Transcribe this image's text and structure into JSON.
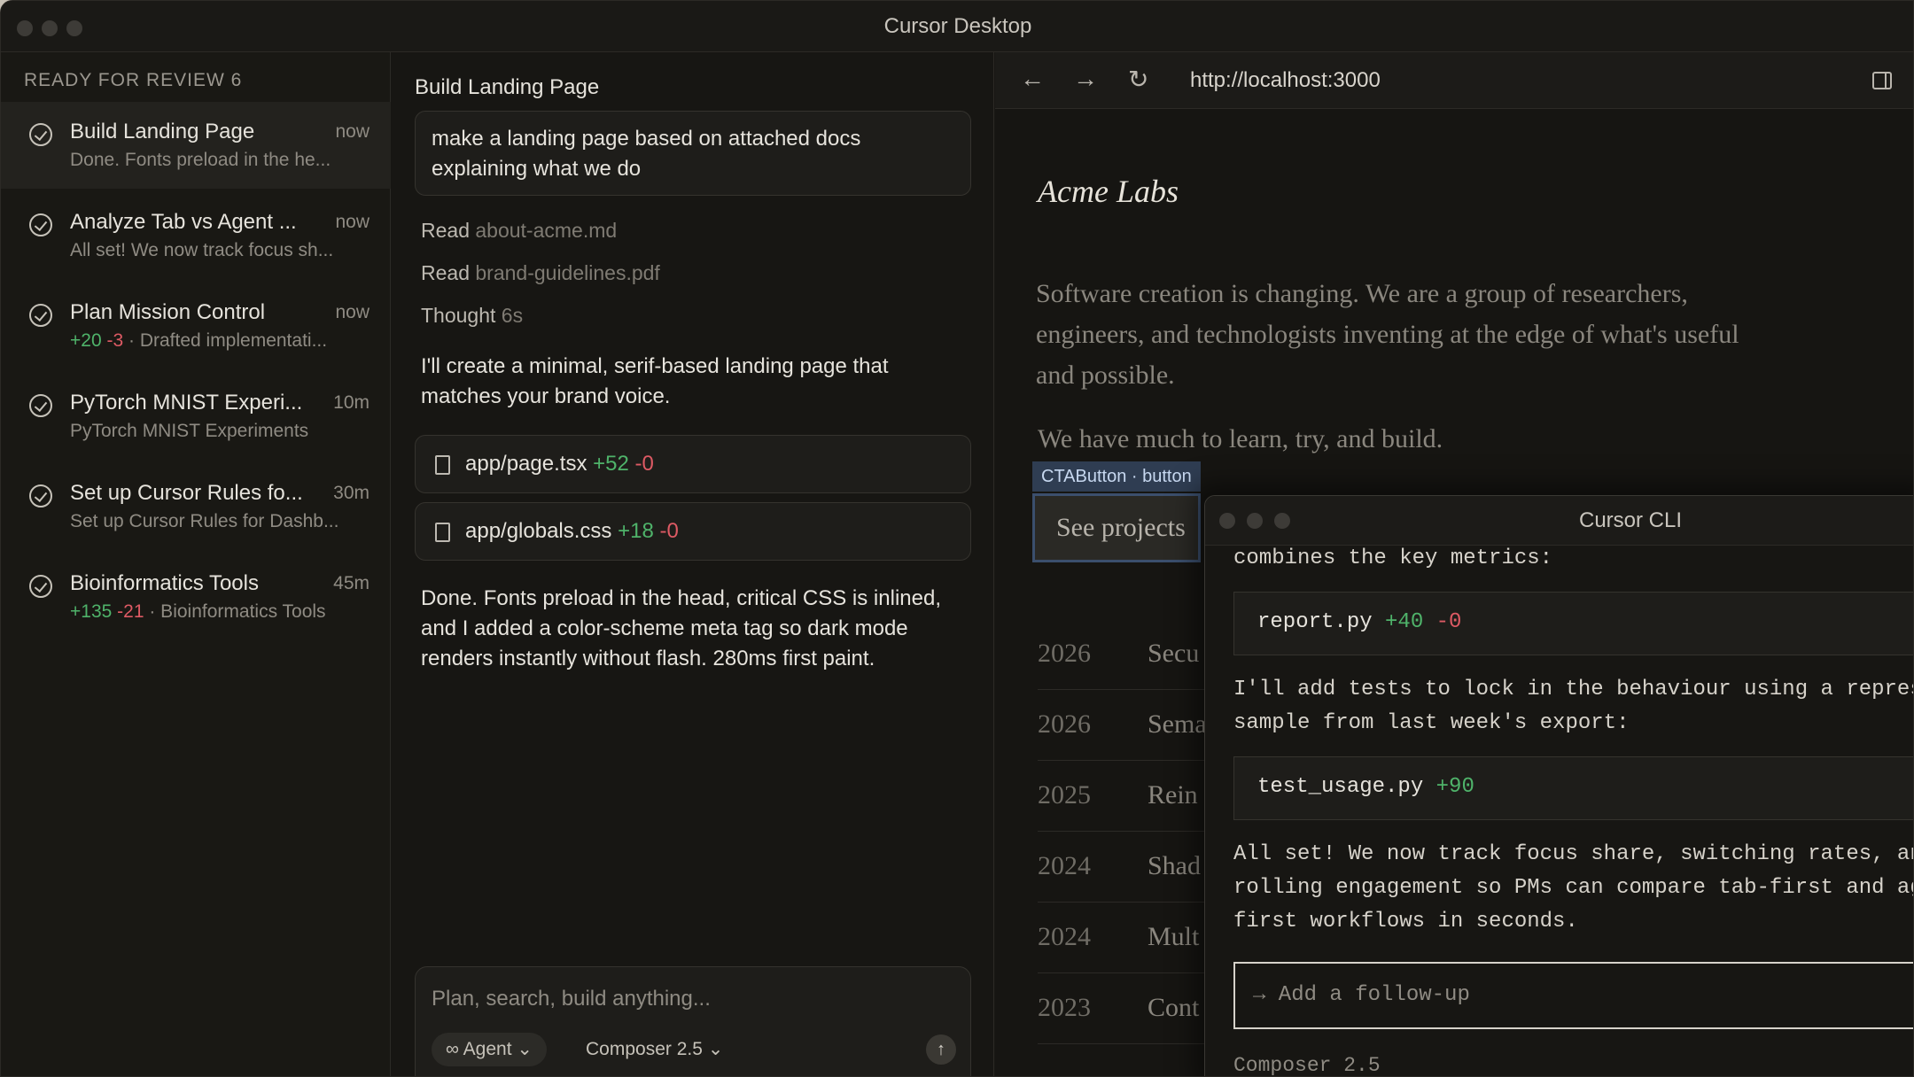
{
  "window": {
    "title": "Cursor Desktop"
  },
  "sidebar": {
    "section_title": "READY FOR REVIEW 6",
    "items": [
      {
        "name": "Build Landing Page",
        "time": "now",
        "sub": "Done. Fonts preload in the he...",
        "plus": "",
        "minus": ""
      },
      {
        "name": "Analyze Tab vs Agent ...",
        "time": "now",
        "sub": "All set! We now track focus sh...",
        "plus": "",
        "minus": ""
      },
      {
        "name": "Plan Mission Control",
        "time": "now",
        "sub": "· Drafted implementati...",
        "plus": "+20",
        "minus": "-3"
      },
      {
        "name": "PyTorch MNIST Experi...",
        "time": "10m",
        "sub": "PyTorch MNIST Experiments",
        "plus": "",
        "minus": ""
      },
      {
        "name": "Set up Cursor Rules fo...",
        "time": "30m",
        "sub": "Set up Cursor Rules for Dashb...",
        "plus": "",
        "minus": ""
      },
      {
        "name": "Bioinformatics Tools",
        "time": "45m",
        "sub": "· Bioinformatics Tools",
        "plus": "+135",
        "minus": "-21"
      }
    ]
  },
  "chat": {
    "title": "Build Landing Page",
    "prompt": "make a landing page based on attached docs explaining what we do",
    "steps": [
      {
        "verb": "Read",
        "target": "about-acme.md"
      },
      {
        "verb": "Read",
        "target": "brand-guidelines.pdf"
      },
      {
        "verb": "Thought",
        "target": "6s"
      }
    ],
    "message1": "I'll create a minimal, serif-based landing page that matches your brand voice.",
    "files": [
      {
        "name": "app/page.tsx",
        "plus": "+52",
        "minus": "-0"
      },
      {
        "name": "app/globals.css",
        "plus": "+18",
        "minus": "-0"
      }
    ],
    "message2": "Done. Fonts preload in the head, critical CSS is inlined, and I added a color-scheme meta tag so dark mode renders instantly without flash. 280ms first paint.",
    "composer": {
      "placeholder": "Plan, search, build anything...",
      "mode": "Agent",
      "model": "Composer 2.5"
    }
  },
  "browser": {
    "url": "http://localhost:3000",
    "site": {
      "brand": "Acme Labs",
      "intro": "Software creation is changing. We are a group of researchers, engineers, and technologists inventing at the edge of what's useful and possible.",
      "line": "We have much to learn, try, and build.",
      "cta_tag": "CTAButton · button",
      "cta": "See projects",
      "rows": [
        {
          "year": "2026",
          "title": "Secu"
        },
        {
          "year": "2026",
          "title": "Sema"
        },
        {
          "year": "2025",
          "title": "Rein"
        },
        {
          "year": "2024",
          "title": "Shad"
        },
        {
          "year": "2024",
          "title": "Mult"
        },
        {
          "year": "2023",
          "title": "Cont"
        }
      ]
    }
  },
  "cli": {
    "title": "Cursor CLI",
    "line1": "combines the key metrics:",
    "card1": {
      "name": "report.py",
      "plus": "+40",
      "minus": "-0"
    },
    "line2a": "I'll add tests to lock in the behaviour using a repres",
    "line2b": "sample from last week's export:",
    "card2": {
      "name": "test_usage.py",
      "plus": "+90"
    },
    "line3a": "All set! We now track focus share, switching rates, an",
    "line3b": "rolling engagement so PMs can compare tab-first and ag",
    "line3c": "first workflows in seconds.",
    "input_placeholder": "→ Add a follow-up",
    "model": "Composer 2.5"
  }
}
